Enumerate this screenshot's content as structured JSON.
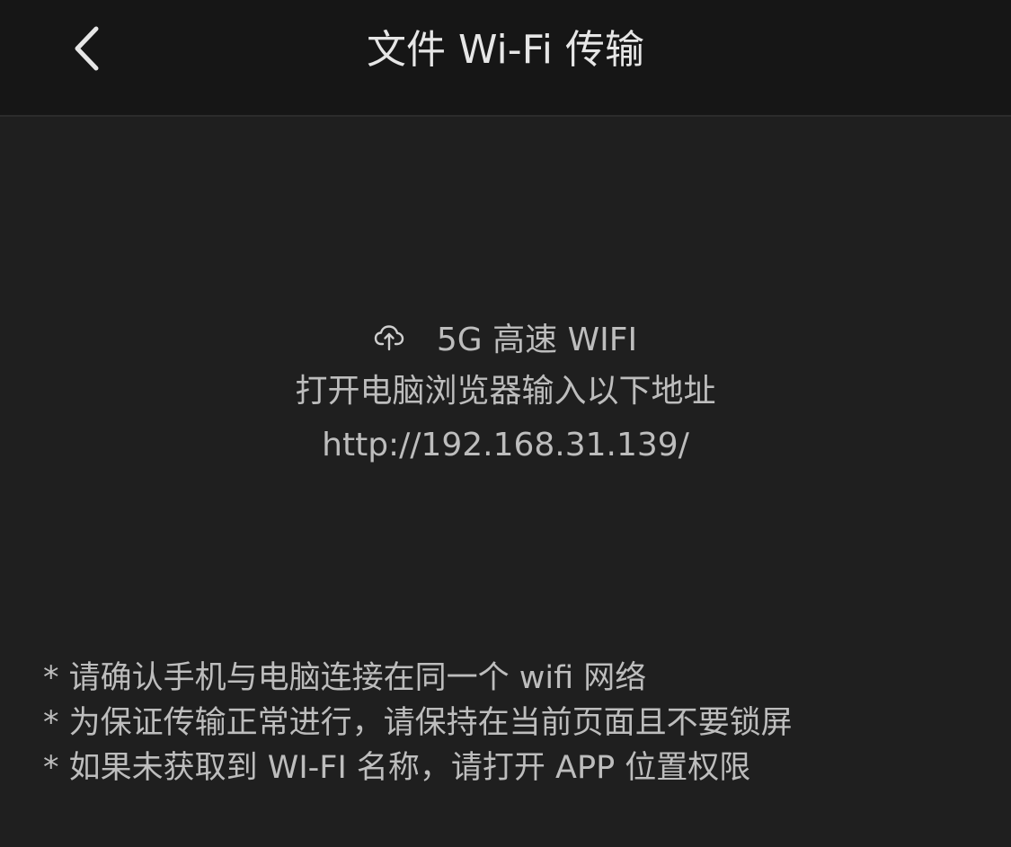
{
  "header": {
    "title": "文件 Wi-Fi 传输",
    "back_icon": "chevron-left-icon"
  },
  "main": {
    "wifi_icon": "cloud-upload-icon",
    "wifi_label": "5G 高速 WIFI",
    "instruction": "打开电脑浏览器输入以下地址",
    "address": "http://192.168.31.139/"
  },
  "notes": [
    "* 请确认手机与电脑连接在同一个 wifi 网络",
    "* 为保证传输正常进行，请保持在当前页面且不要锁屏",
    "* 如果未获取到 WI-FI 名称，请打开 APP 位置权限"
  ],
  "colors": {
    "background": "#1f1f1f",
    "nav_background": "#161616",
    "text": "#bdbdbd",
    "title_text": "#e6e6e6"
  }
}
